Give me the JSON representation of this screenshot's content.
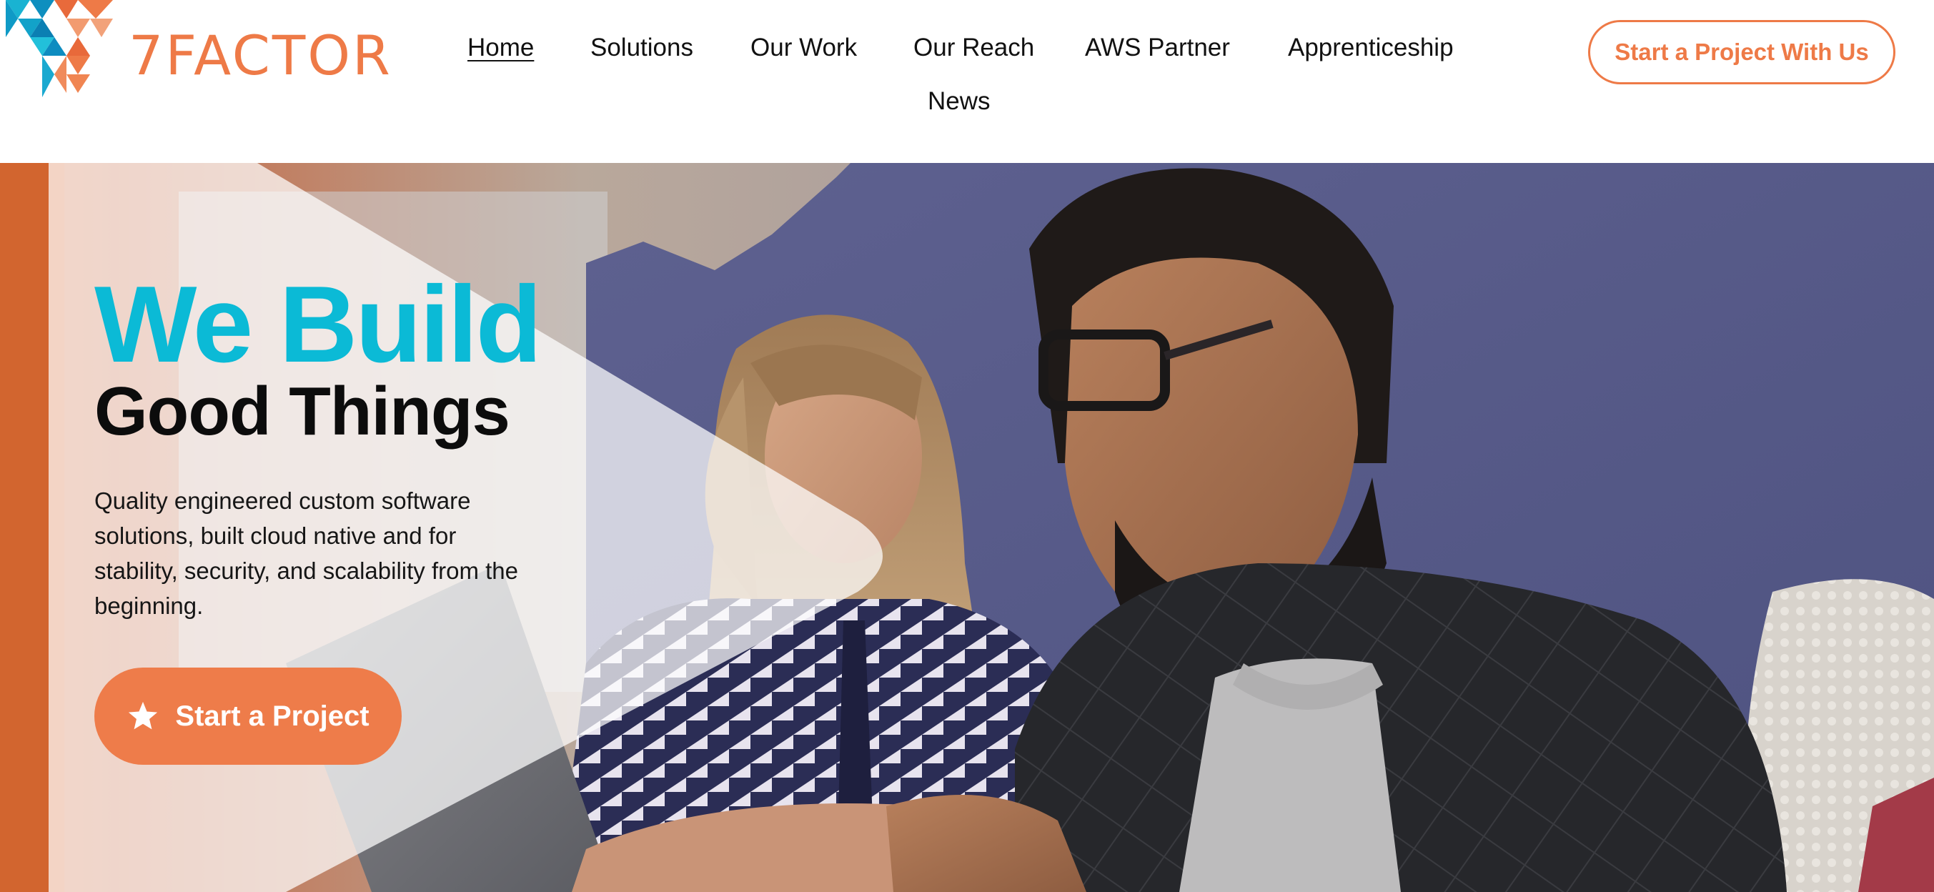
{
  "brand": {
    "name": "7FACTOR",
    "colors": {
      "orange": "#ee7a47",
      "teal": "#0bbad6",
      "text": "#111111"
    }
  },
  "nav": {
    "items": [
      {
        "label": "Home",
        "active": true
      },
      {
        "label": "Solutions"
      },
      {
        "label": "Our Work"
      },
      {
        "label": "Our Reach"
      },
      {
        "label": "AWS Partner"
      },
      {
        "label": "Apprenticeship"
      },
      {
        "label": "News"
      }
    ]
  },
  "header_cta": {
    "label": "Start a Project With Us"
  },
  "hero": {
    "title_line1": "We Build",
    "title_line2": "Good Things",
    "description": "Quality engineered custom software solutions, built cloud native and for stability, security, and scalability from the beginning.",
    "cta_label": "Start a Project",
    "cta_icon": "star-icon"
  }
}
